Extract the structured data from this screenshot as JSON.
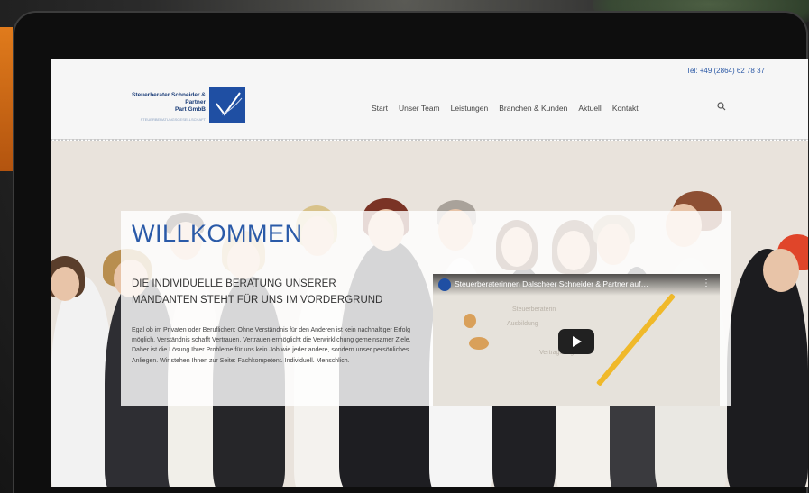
{
  "header": {
    "phone": "Tel: +49 (2864) 62 78 37",
    "logo_name_line1": "Steuerberater Schneider & Partner",
    "logo_name_line2": "Part GmbB",
    "logo_sub": "STEUERBERATUNGSGESELLSCHAFT"
  },
  "nav": {
    "items": [
      "Start",
      "Unser Team",
      "Leistungen",
      "Branchen & Kunden",
      "Aktuell",
      "Kontakt"
    ],
    "search_icon": "search-icon"
  },
  "content": {
    "title": "WILLKOMMEN",
    "subtitle": "DIE INDIVIDUELLE BERATUNG UNSERER MANDANTEN STEHT FÜR UNS IM VORDERGRUND",
    "body": "Egal ob im Privaten oder Beruflichen: Ohne Verständnis für den Anderen ist kein nachhaltiger Erfolg möglich. Verständnis schafft Vertrauen. Vertrauen ermöglicht die Verwirklichung gemeinsamer Ziele. Daher ist die Lösung Ihrer Probleme für uns kein Job wie jeder andere, sondern unser persönliches Anliegen. Wir stehen Ihnen zur Seite: Fachkompetent. Individuell. Menschlich."
  },
  "video": {
    "title": "Steuerberaterinnen Dalscheer Schneider & Partner auf…",
    "menu_icon": "more-vert-icon",
    "play_icon": "play-icon"
  },
  "colors": {
    "brand_blue": "#2a5aa8",
    "logo_blue": "#1f4fa3",
    "play_button": "#212121"
  }
}
